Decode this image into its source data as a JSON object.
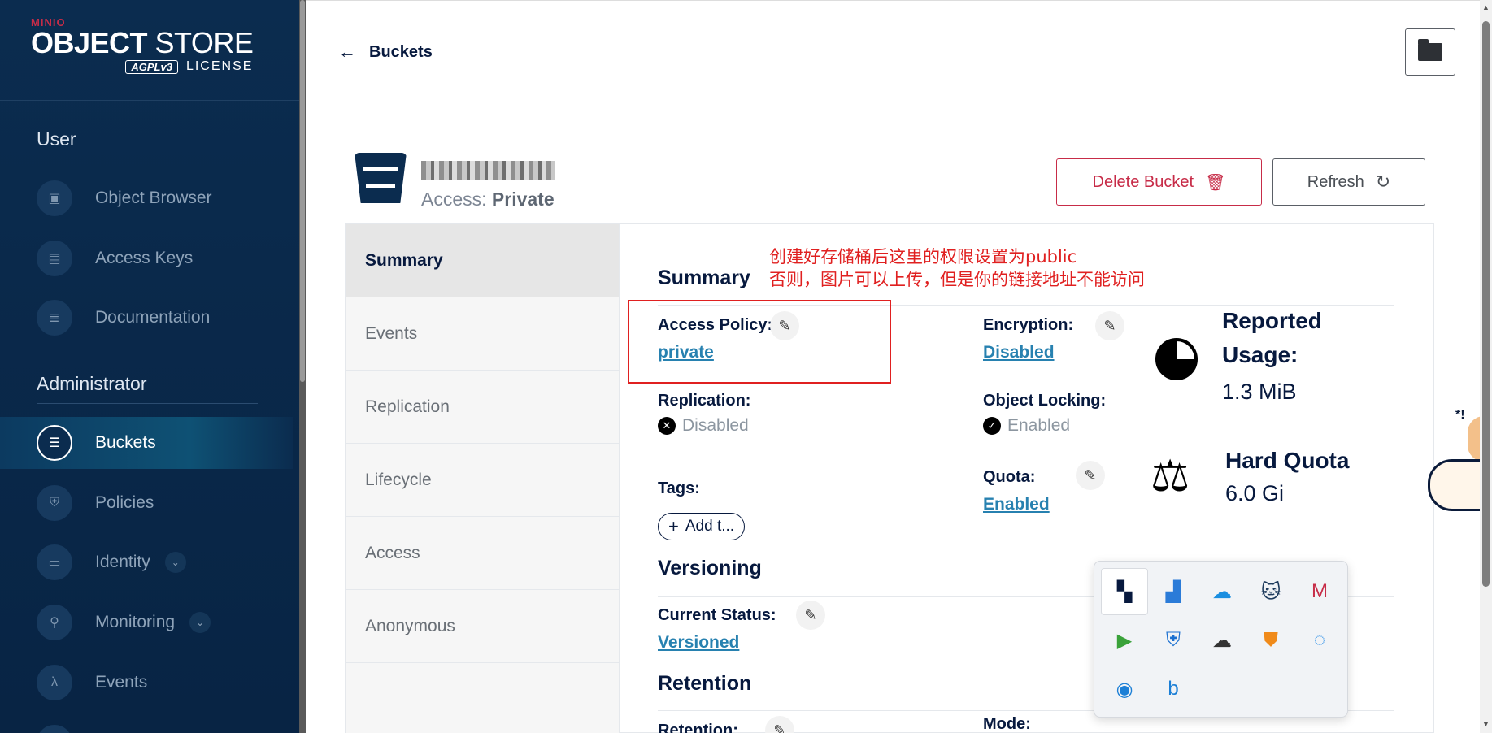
{
  "logo": {
    "brand": "MINIO",
    "title_bold": "OBJECT",
    "title_rest": " STORE",
    "agpl": "AGPLv3",
    "license": "LICENSE"
  },
  "sidebar": {
    "user_section": "User",
    "user_items": [
      {
        "label": "Object Browser",
        "icon": "object-browser-icon"
      },
      {
        "label": "Access Keys",
        "icon": "access-keys-icon"
      },
      {
        "label": "Documentation",
        "icon": "documentation-icon"
      }
    ],
    "admin_section": "Administrator",
    "admin_items": [
      {
        "label": "Buckets",
        "icon": "bucket-icon",
        "active": true
      },
      {
        "label": "Policies",
        "icon": "shield-icon"
      },
      {
        "label": "Identity",
        "icon": "identity-icon",
        "expandable": true
      },
      {
        "label": "Monitoring",
        "icon": "monitoring-icon",
        "expandable": true
      },
      {
        "label": "Events",
        "icon": "lambda-icon"
      }
    ]
  },
  "header": {
    "back_label": "Buckets"
  },
  "bucket": {
    "access_label": "Access: ",
    "access_value": "Private",
    "delete_label": "Delete Bucket",
    "refresh_label": "Refresh"
  },
  "tabs": [
    "Summary",
    "Events",
    "Replication",
    "Lifecycle",
    "Access",
    "Anonymous"
  ],
  "summary": {
    "heading": "Summary",
    "access_policy_label": "Access Policy:",
    "access_policy_value": "private",
    "encryption_label": "Encryption:",
    "encryption_value": "Disabled",
    "replication_label": "Replication:",
    "replication_value": "Disabled",
    "object_locking_label": "Object Locking:",
    "object_locking_value": "Enabled",
    "tags_label": "Tags:",
    "add_tag_label": "Add t...",
    "quota_label": "Quota:",
    "quota_value": "Enabled",
    "reported_usage_title_1": "Reported",
    "reported_usage_title_2": "Usage:",
    "reported_usage_value": "1.3 MiB",
    "hard_quota_title": "Hard Quota",
    "hard_quota_value": "6.0 Gi"
  },
  "versioning": {
    "heading": "Versioning",
    "current_status_label": "Current Status:",
    "current_status_value": "Versioned"
  },
  "retention": {
    "heading": "Retention",
    "retention_label": "Retention:",
    "mode_label": "Mode:"
  },
  "annotation": {
    "line1": "创建好存储桶后这里的权限设置为public",
    "line2": "否则，图片可以上传，但是你的链接地址不能访问"
  },
  "tray_icons": [
    "app-grid-icon",
    "image-viewer-icon",
    "cloud-icon",
    "cat-icon",
    "m-logo-icon",
    "play-icon",
    "defender-warning-icon",
    "cloud-offline-icon",
    "firewall-icon",
    "chat-icon",
    "edge-icon",
    "bing-icon"
  ],
  "colors": {
    "sidebar_bg": "#0b2c4f",
    "danger": "#c72c48",
    "link": "#2781b0",
    "annotation": "#e02020"
  }
}
